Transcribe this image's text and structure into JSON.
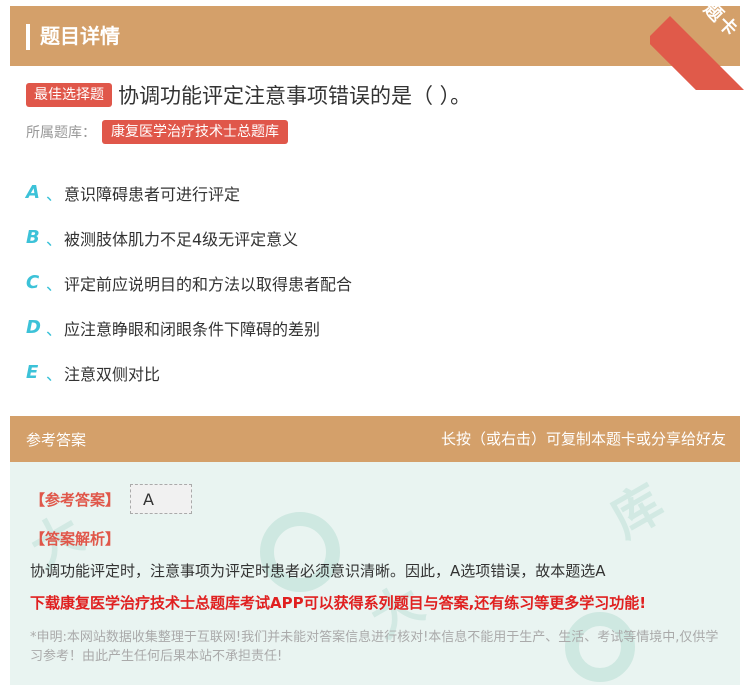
{
  "header": {
    "title": "题目详情",
    "corner_label": "题卡"
  },
  "question": {
    "type_tag": "最佳选择题",
    "text": "协调功能评定注意事项错误的是（ ）。",
    "bank_label": "所属题库：",
    "bank_name": "康复医学治疗技术士总题库"
  },
  "options": [
    {
      "letter": "A",
      "sep": "、",
      "text": "意识障碍患者可进行评定"
    },
    {
      "letter": "B",
      "sep": "、",
      "text": "被测肢体肌力不足4级无评定意义"
    },
    {
      "letter": "C",
      "sep": "、",
      "text": "评定前应说明目的和方法以取得患者配合"
    },
    {
      "letter": "D",
      "sep": "、",
      "text": "应注意睁眼和闭眼条件下障碍的差别"
    },
    {
      "letter": "E",
      "sep": "、",
      "text": "注意双侧对比"
    }
  ],
  "answer_section": {
    "title": "参考答案",
    "hint": "长按（或右击）可复制本题卡或分享给好友",
    "answer_label": "【参考答案】",
    "answer_value": "A",
    "analysis_label": "【答案解析】",
    "analysis_text": "协调功能评定时，注意事项为评定时患者必须意识清晰。因此，A选项错误，故本题选A",
    "download_text": "下载康复医学治疗技术士总题库考试APP可以获得系列题目与答案,还有练习等更多学习功能!",
    "disclaimer": "*申明:本网站数据收集整理于互联网!我们并未能对答案信息进行核对!本信息不能用于生产、生活、考试等情境中,仅供学习参考！由此产生任何后果本站不承担责任!"
  },
  "colors": {
    "header_bg": "#d4a06a",
    "tag_red": "#e0574a",
    "option_letter": "#3cc2d8",
    "answer_bg": "#e9f4f1"
  }
}
